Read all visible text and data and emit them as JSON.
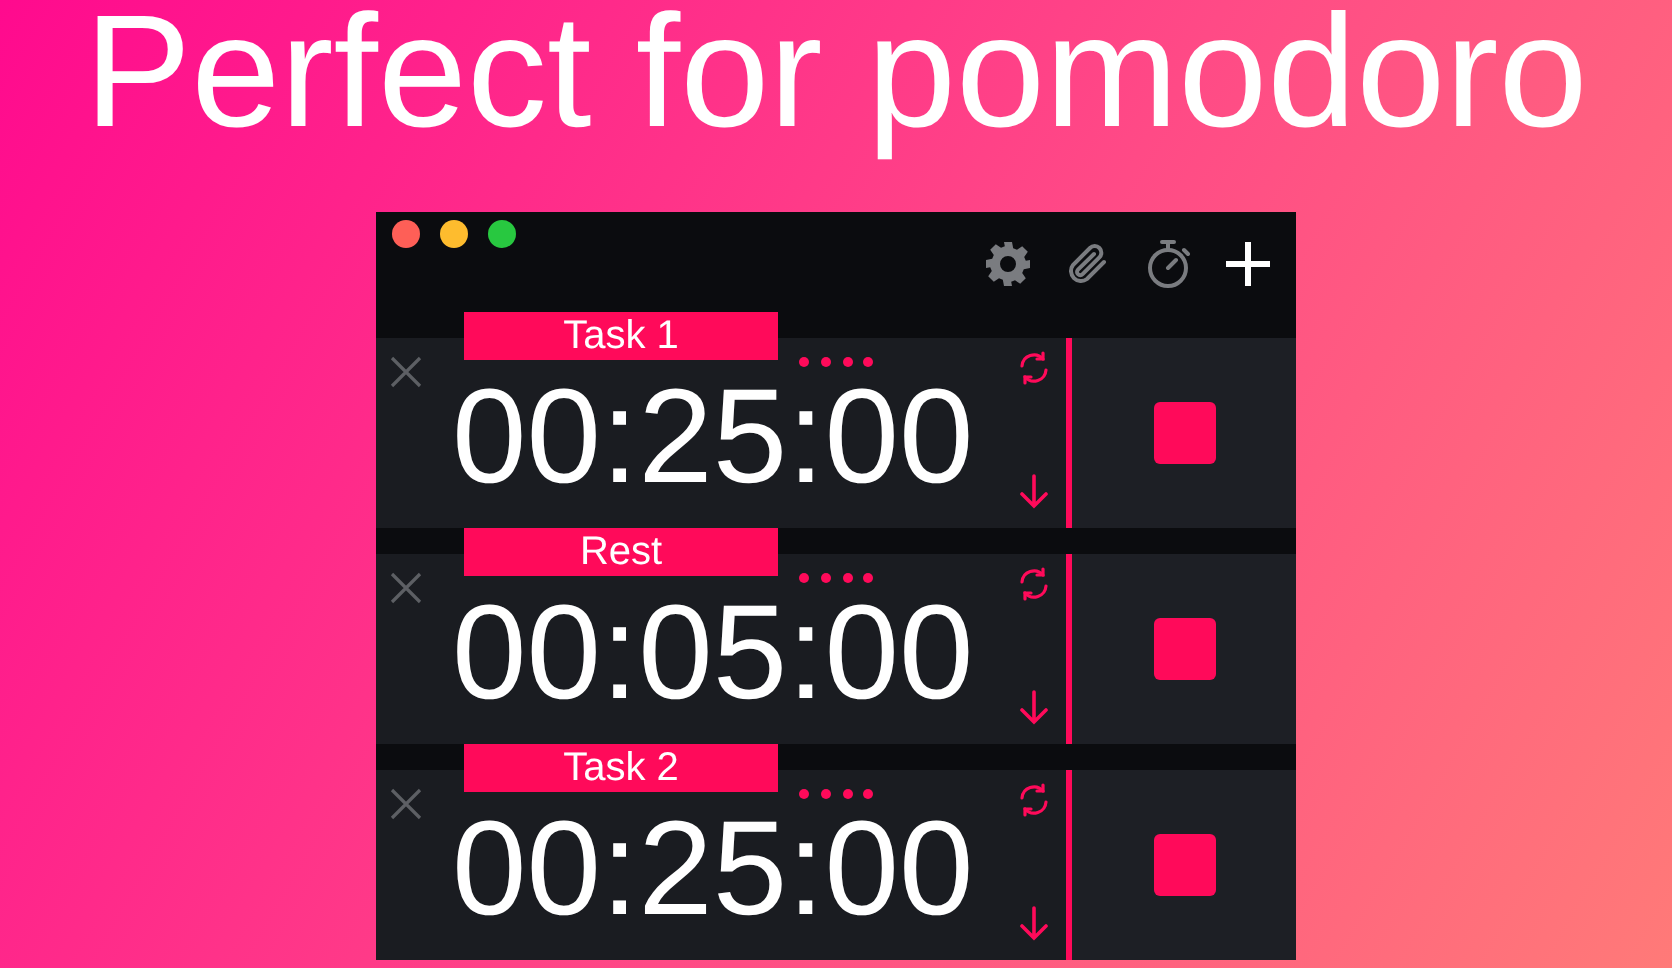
{
  "headline": "Perfect for pomodoro",
  "timers": [
    {
      "label": "Task 1",
      "time": "00:25:00"
    },
    {
      "label": "Rest",
      "time": "00:05:00"
    },
    {
      "label": "Task 2",
      "time": "00:25:00"
    }
  ]
}
